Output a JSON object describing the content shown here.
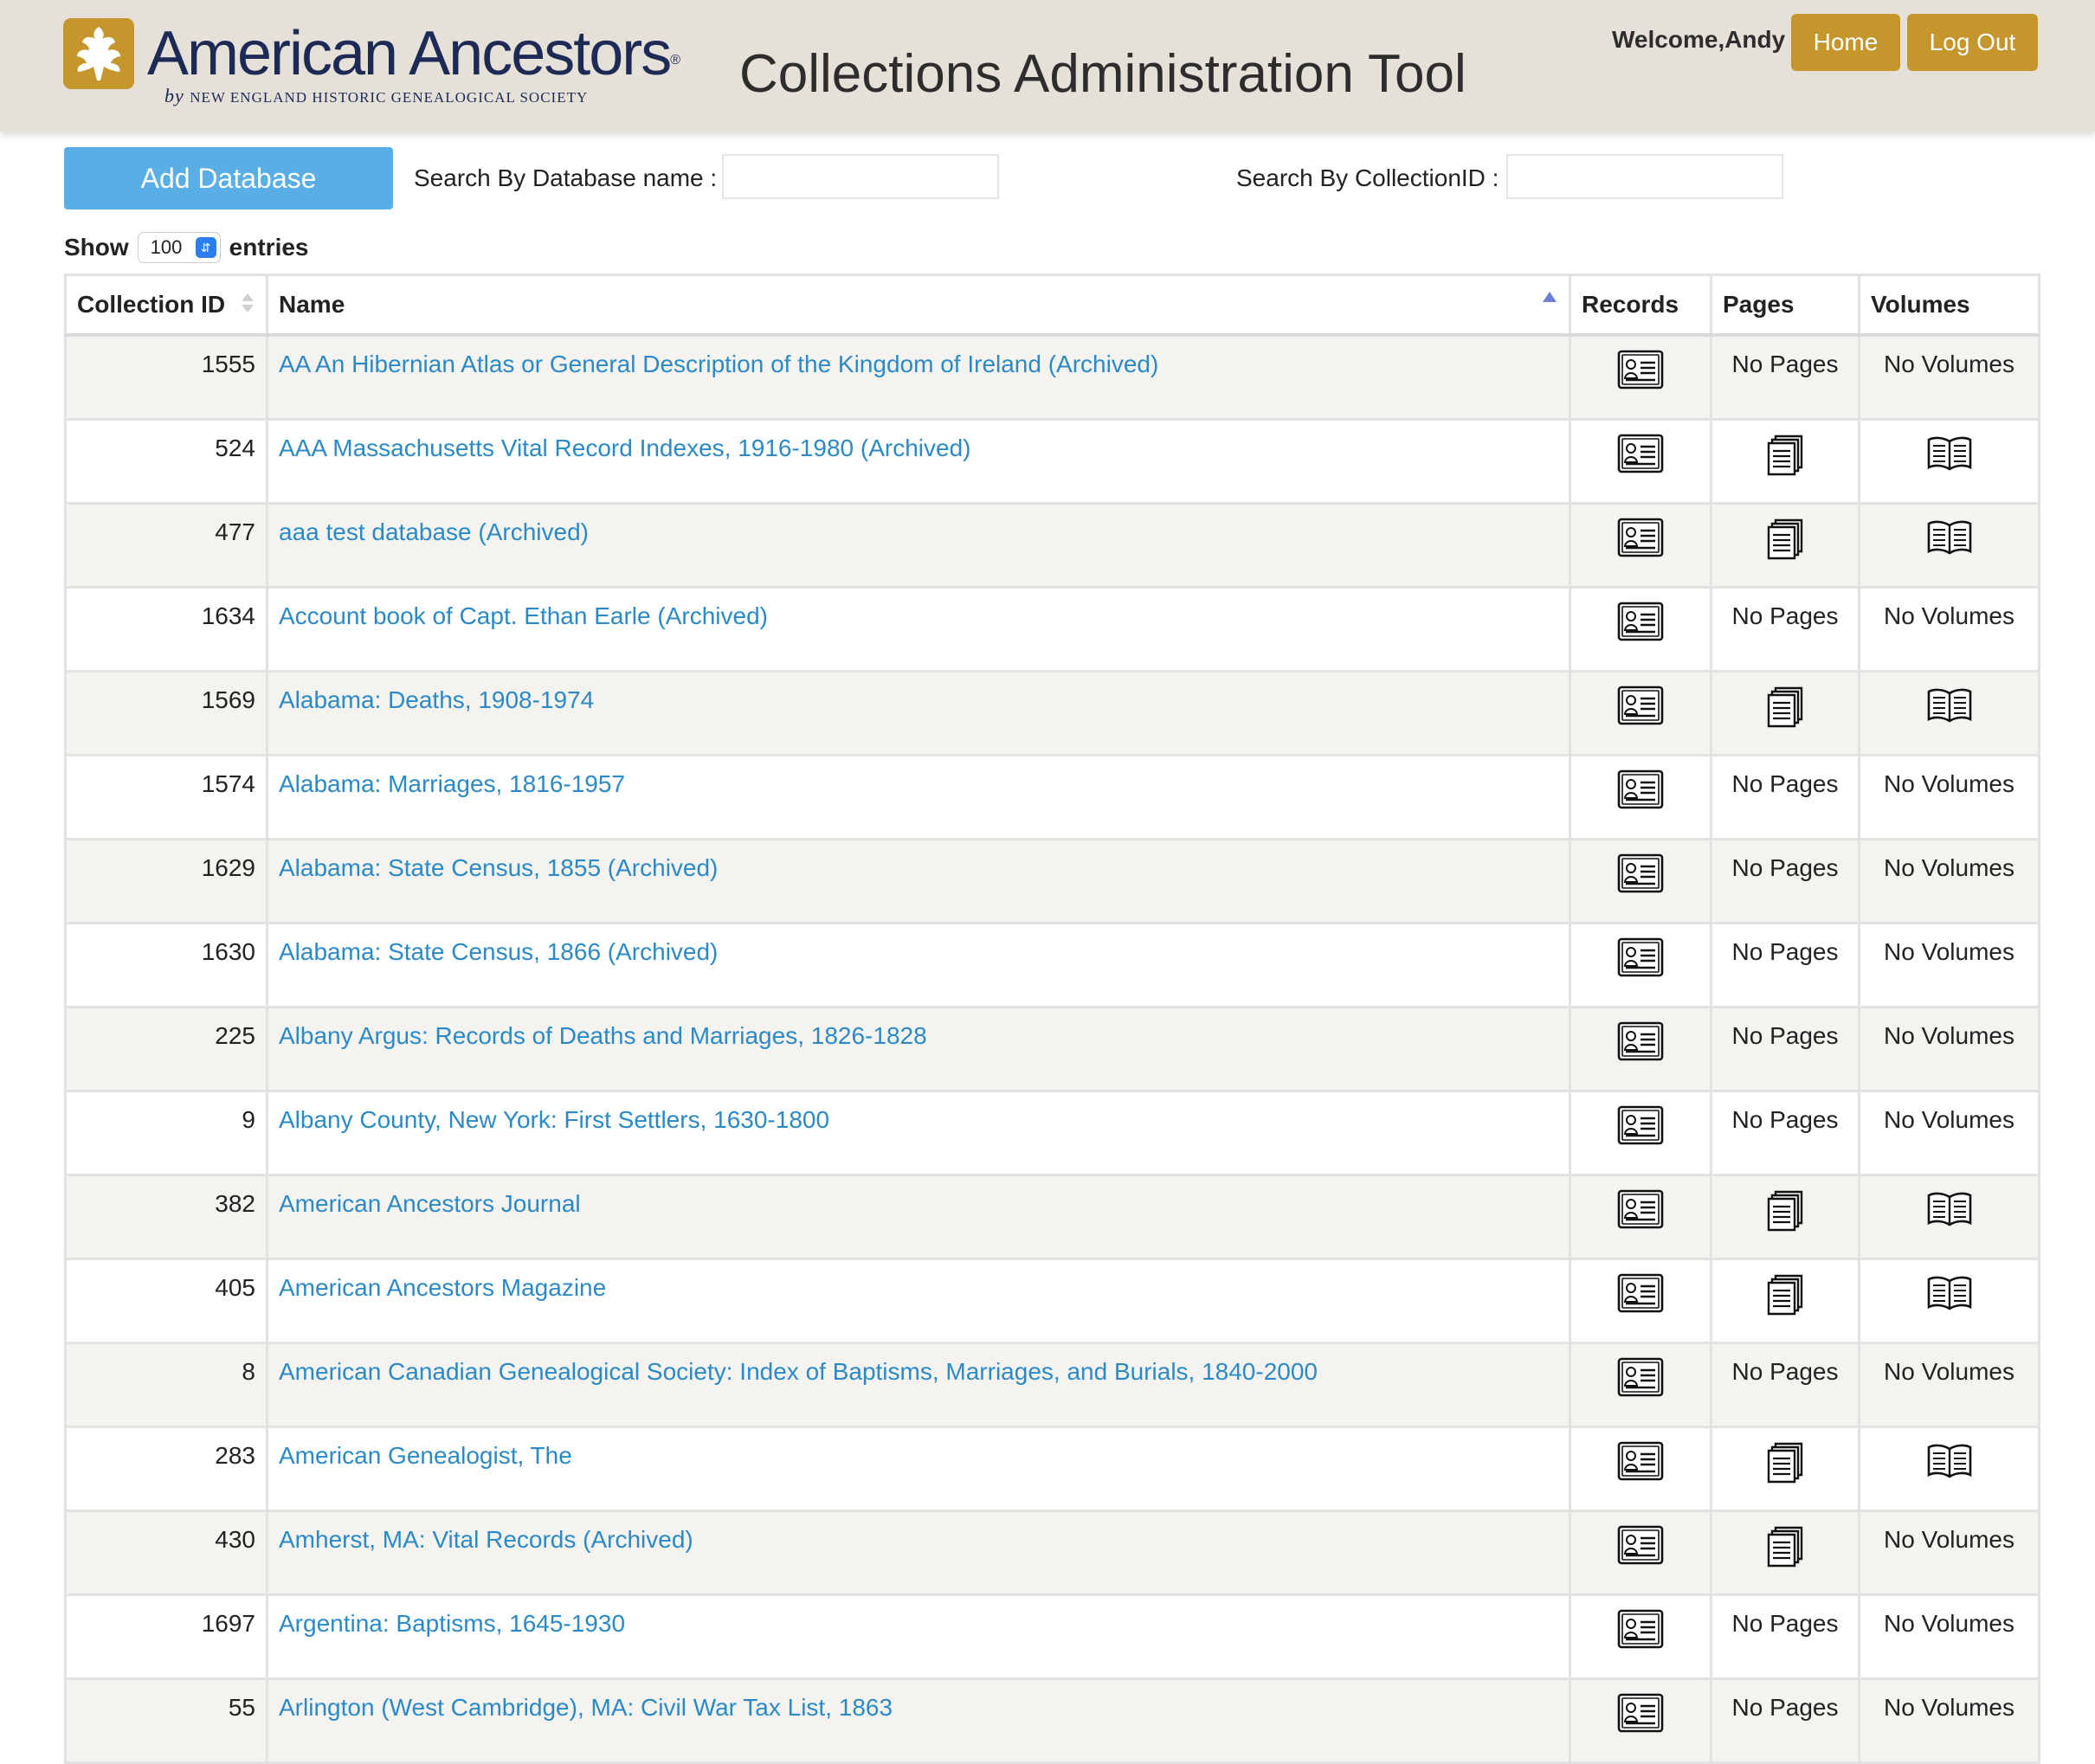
{
  "header": {
    "brand_name": "American Ancestors",
    "brand_reg": "®",
    "brand_sub_by": "by",
    "brand_sub_org": "New England Historic Genealogical Society",
    "app_title": "Collections Administration Tool",
    "welcome": "Welcome,Andy",
    "home_label": "Home",
    "logout_label": "Log Out"
  },
  "toolbar": {
    "add_label": "Add Database",
    "search_db_label": "Search By Database name :",
    "search_db_value": "",
    "search_cid_label": "Search By CollectionID :",
    "search_cid_value": "",
    "show_label": "Show",
    "entries_value": "100",
    "entries_label": "entries"
  },
  "table": {
    "columns": [
      "Collection ID",
      "Name",
      "Records",
      "Pages",
      "Volumes"
    ],
    "rows": [
      {
        "id": "1555",
        "name": "AA An Hibernian Atlas or General Description of the Kingdom of Ireland (Archived)",
        "records": true,
        "pages": "No Pages",
        "volumes": "No Volumes"
      },
      {
        "id": "524",
        "name": "AAA Massachusetts Vital Record Indexes, 1916-1980 (Archived)",
        "records": true,
        "pages": "",
        "volumes": ""
      },
      {
        "id": "477",
        "name": "aaa test database (Archived)",
        "records": true,
        "pages": "",
        "volumes": ""
      },
      {
        "id": "1634",
        "name": "Account book of Capt. Ethan Earle (Archived)",
        "records": true,
        "pages": "No Pages",
        "volumes": "No Volumes"
      },
      {
        "id": "1569",
        "name": "Alabama: Deaths, 1908-1974",
        "records": true,
        "pages": "",
        "volumes": ""
      },
      {
        "id": "1574",
        "name": "Alabama: Marriages, 1816-1957",
        "records": true,
        "pages": "No Pages",
        "volumes": "No Volumes"
      },
      {
        "id": "1629",
        "name": "Alabama: State Census, 1855 (Archived)",
        "records": true,
        "pages": "No Pages",
        "volumes": "No Volumes"
      },
      {
        "id": "1630",
        "name": "Alabama: State Census, 1866 (Archived)",
        "records": true,
        "pages": "No Pages",
        "volumes": "No Volumes"
      },
      {
        "id": "225",
        "name": "Albany Argus: Records of Deaths and Marriages, 1826-1828",
        "records": true,
        "pages": "No Pages",
        "volumes": "No Volumes"
      },
      {
        "id": "9",
        "name": "Albany County, New York: First Settlers, 1630-1800",
        "records": true,
        "pages": "No Pages",
        "volumes": "No Volumes"
      },
      {
        "id": "382",
        "name": "American Ancestors Journal",
        "records": true,
        "pages": "",
        "volumes": ""
      },
      {
        "id": "405",
        "name": "American Ancestors Magazine",
        "records": true,
        "pages": "",
        "volumes": ""
      },
      {
        "id": "8",
        "name": "American Canadian Genealogical Society: Index of Baptisms, Marriages, and Burials, 1840-2000",
        "records": true,
        "pages": "No Pages",
        "volumes": "No Volumes"
      },
      {
        "id": "283",
        "name": "American Genealogist, The",
        "records": true,
        "pages": "",
        "volumes": ""
      },
      {
        "id": "430",
        "name": "Amherst, MA: Vital Records (Archived)",
        "records": true,
        "pages": "",
        "volumes": "No Volumes"
      },
      {
        "id": "1697",
        "name": "Argentina: Baptisms, 1645-1930",
        "records": true,
        "pages": "No Pages",
        "volumes": "No Volumes"
      },
      {
        "id": "55",
        "name": "Arlington (West Cambridge), MA: Civil War Tax List, 1863",
        "records": true,
        "pages": "No Pages",
        "volumes": "No Volumes"
      }
    ]
  },
  "colors": {
    "header_bg": "#e5e1d9",
    "brand_gold": "#c4962c",
    "brand_navy": "#1d2a55",
    "add_button": "#5aaee6",
    "link": "#2b8ac6",
    "odd_row": "#f4f3f0"
  },
  "icons": {
    "logo": "oak-leaf-icon",
    "records": "record-card-icon",
    "pages": "pages-icon",
    "volumes": "open-book-icon"
  }
}
